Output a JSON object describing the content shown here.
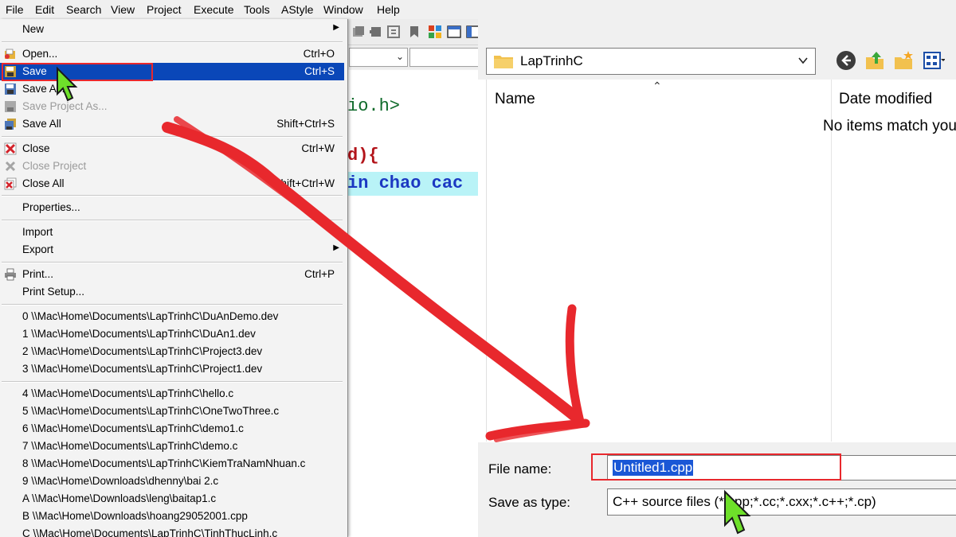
{
  "menubar": {
    "items": [
      "File",
      "Edit",
      "Search",
      "View",
      "Project",
      "Execute",
      "Tools",
      "AStyle",
      "Window",
      "Help"
    ]
  },
  "editor": {
    "lines": [
      "io.h>",
      "d){",
      "in chao cac"
    ]
  },
  "file_menu": {
    "new": "New",
    "open": {
      "label": "Open...",
      "shortcut": "Ctrl+O"
    },
    "save": {
      "label": "Save",
      "shortcut": "Ctrl+S"
    },
    "save_as": "Save As...",
    "save_project_as": "Save Project As...",
    "save_all": {
      "label": "Save All",
      "shortcut": "Shift+Ctrl+S"
    },
    "close": {
      "label": "Close",
      "shortcut": "Ctrl+W"
    },
    "close_project": "Close Project",
    "close_all": {
      "label": "Close All",
      "shortcut": "Shift+Ctrl+W"
    },
    "properties": "Properties...",
    "import": "Import",
    "export": "Export",
    "print": {
      "label": "Print...",
      "shortcut": "Ctrl+P"
    },
    "print_setup": "Print Setup...",
    "recent_projects": [
      "0 \\\\Mac\\Home\\Documents\\LapTrinhC\\DuAnDemo.dev",
      "1 \\\\Mac\\Home\\Documents\\LapTrinhC\\DuAn1.dev",
      "2 \\\\Mac\\Home\\Documents\\LapTrinhC\\Project3.dev",
      "3 \\\\Mac\\Home\\Documents\\LapTrinhC\\Project1.dev"
    ],
    "recent_files": [
      "4 \\\\Mac\\Home\\Documents\\LapTrinhC\\hello.c",
      "5 \\\\Mac\\Home\\Documents\\LapTrinhC\\OneTwoThree.c",
      "6 \\\\Mac\\Home\\Documents\\LapTrinhC\\demo1.c",
      "7 \\\\Mac\\Home\\Documents\\LapTrinhC\\demo.c",
      "8 \\\\Mac\\Home\\Documents\\LapTrinhC\\KiemTraNamNhuan.c",
      "9 \\\\Mac\\Home\\Downloads\\dhenny\\bai 2.c",
      "A \\\\Mac\\Home\\Downloads\\leng\\baitap1.c",
      "B \\\\Mac\\Home\\Downloads\\hoang29052001.cpp",
      "C \\\\Mac\\Home\\Documents\\LapTrinhC\\TinhThucLinh.c"
    ]
  },
  "dialog": {
    "location": "LapTrinhC",
    "columns": {
      "name": "Name",
      "date_modified": "Date modified"
    },
    "empty_message": "No items match you",
    "file_name_label": "File name:",
    "file_name_value": "Untitled1.cpp",
    "save_as_type_label": "Save as type:",
    "save_as_type_value": "C++ source files (*.cpp;*.cc;*.cxx;*.c++;*.cp)"
  },
  "colors": {
    "menu_selection": "#0a47b8",
    "annotation_red": "#e8282d",
    "cursor_green": "#6ee02a",
    "code_highlight": "#b9f3f7"
  }
}
